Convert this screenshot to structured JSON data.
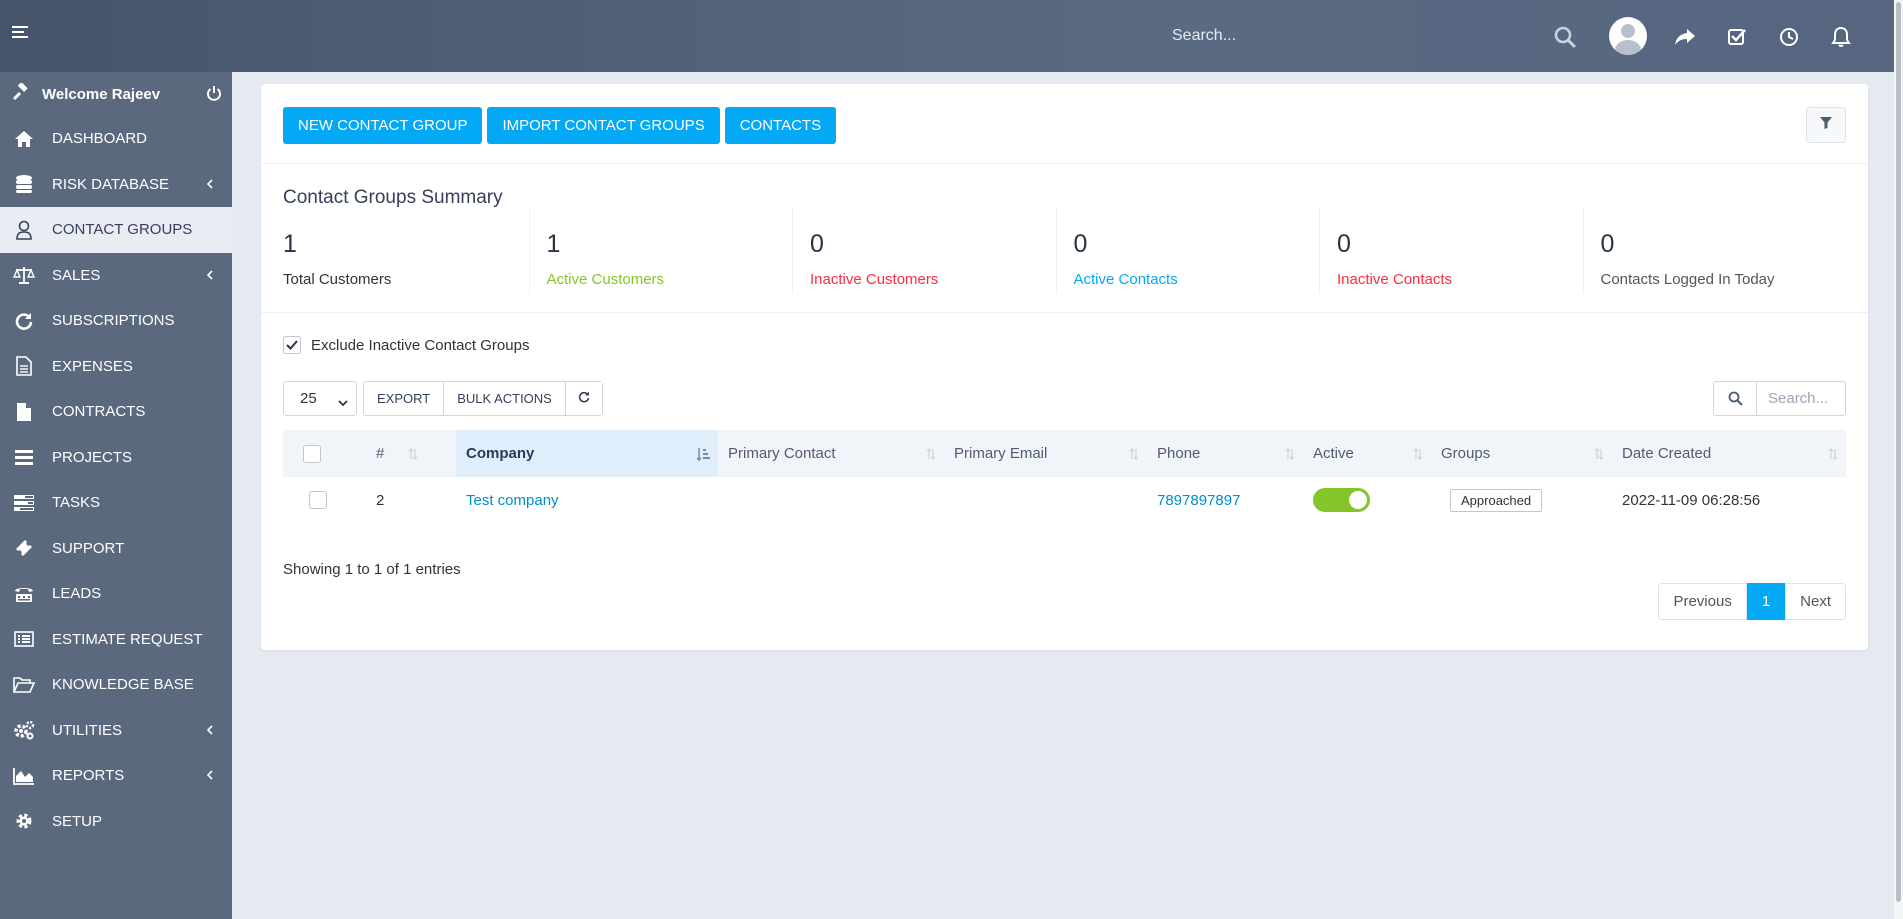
{
  "topbar": {
    "search_placeholder": "Search...",
    "icons": [
      "menu-icon",
      "search-icon",
      "avatar",
      "share-icon",
      "check-square-icon",
      "clock-icon",
      "bell-icon"
    ]
  },
  "sidebar": {
    "welcome": "Welcome Rajeev",
    "items": [
      {
        "label": "DASHBOARD",
        "icon": "home-icon"
      },
      {
        "label": "RISK DATABASE",
        "icon": "database-icon",
        "has_children": true
      },
      {
        "label": "CONTACT GROUPS",
        "icon": "user-icon",
        "active": true
      },
      {
        "label": "SALES",
        "icon": "balance-scale-icon",
        "has_children": true
      },
      {
        "label": "SUBSCRIPTIONS",
        "icon": "refresh-icon"
      },
      {
        "label": "EXPENSES",
        "icon": "file-text-icon"
      },
      {
        "label": "CONTRACTS",
        "icon": "file-icon"
      },
      {
        "label": "PROJECTS",
        "icon": "bars-icon"
      },
      {
        "label": "TASKS",
        "icon": "tasks-icon"
      },
      {
        "label": "SUPPORT",
        "icon": "ticket-icon"
      },
      {
        "label": "LEADS",
        "icon": "tty-icon"
      },
      {
        "label": "ESTIMATE REQUEST",
        "icon": "list-alt-icon"
      },
      {
        "label": "KNOWLEDGE BASE",
        "icon": "folder-open-icon"
      },
      {
        "label": "UTILITIES",
        "icon": "cogs-icon",
        "has_children": true
      },
      {
        "label": "REPORTS",
        "icon": "area-chart-icon",
        "has_children": true
      },
      {
        "label": "SETUP",
        "icon": "cog-icon"
      }
    ]
  },
  "actions": {
    "new_group": "NEW CONTACT GROUP",
    "import_groups": "IMPORT CONTACT GROUPS",
    "contacts": "CONTACTS"
  },
  "summary": {
    "title": "Contact Groups Summary",
    "stats": [
      {
        "value": "1",
        "label": "Total Customers",
        "color": "#333333"
      },
      {
        "value": "1",
        "label": "Active Customers",
        "color": "#84c529"
      },
      {
        "value": "0",
        "label": "Inactive Customers",
        "color": "#fc2d42"
      },
      {
        "value": "0",
        "label": "Active Contacts",
        "color": "#03a9f4"
      },
      {
        "value": "0",
        "label": "Inactive Contacts",
        "color": "#fc2d42"
      },
      {
        "value": "0",
        "label": "Contacts Logged In Today",
        "color": "#555555"
      }
    ]
  },
  "filters": {
    "exclude_inactive": "Exclude Inactive Contact Groups",
    "exclude_checked": true
  },
  "table_controls": {
    "page_length": "25",
    "export": "EXPORT",
    "bulk_actions": "BULK ACTIONS",
    "search_placeholder": "Search..."
  },
  "table": {
    "columns": [
      "#",
      "Company",
      "Primary Contact",
      "Primary Email",
      "Phone",
      "Active",
      "Groups",
      "Date Created"
    ],
    "rows": [
      {
        "id": "2",
        "company": "Test company",
        "primary_contact": "",
        "primary_email": "",
        "phone": "7897897897",
        "active": true,
        "group": "Approached",
        "date_created": "2022-11-09 06:28:56"
      }
    ]
  },
  "pagination": {
    "info": "Showing 1 to 1 of 1 entries",
    "previous": "Previous",
    "current": "1",
    "next": "Next"
  },
  "colors": {
    "primary": "#03a9f4",
    "sidebar": "#5b697f",
    "success": "#84c529",
    "danger": "#fc2d42"
  }
}
